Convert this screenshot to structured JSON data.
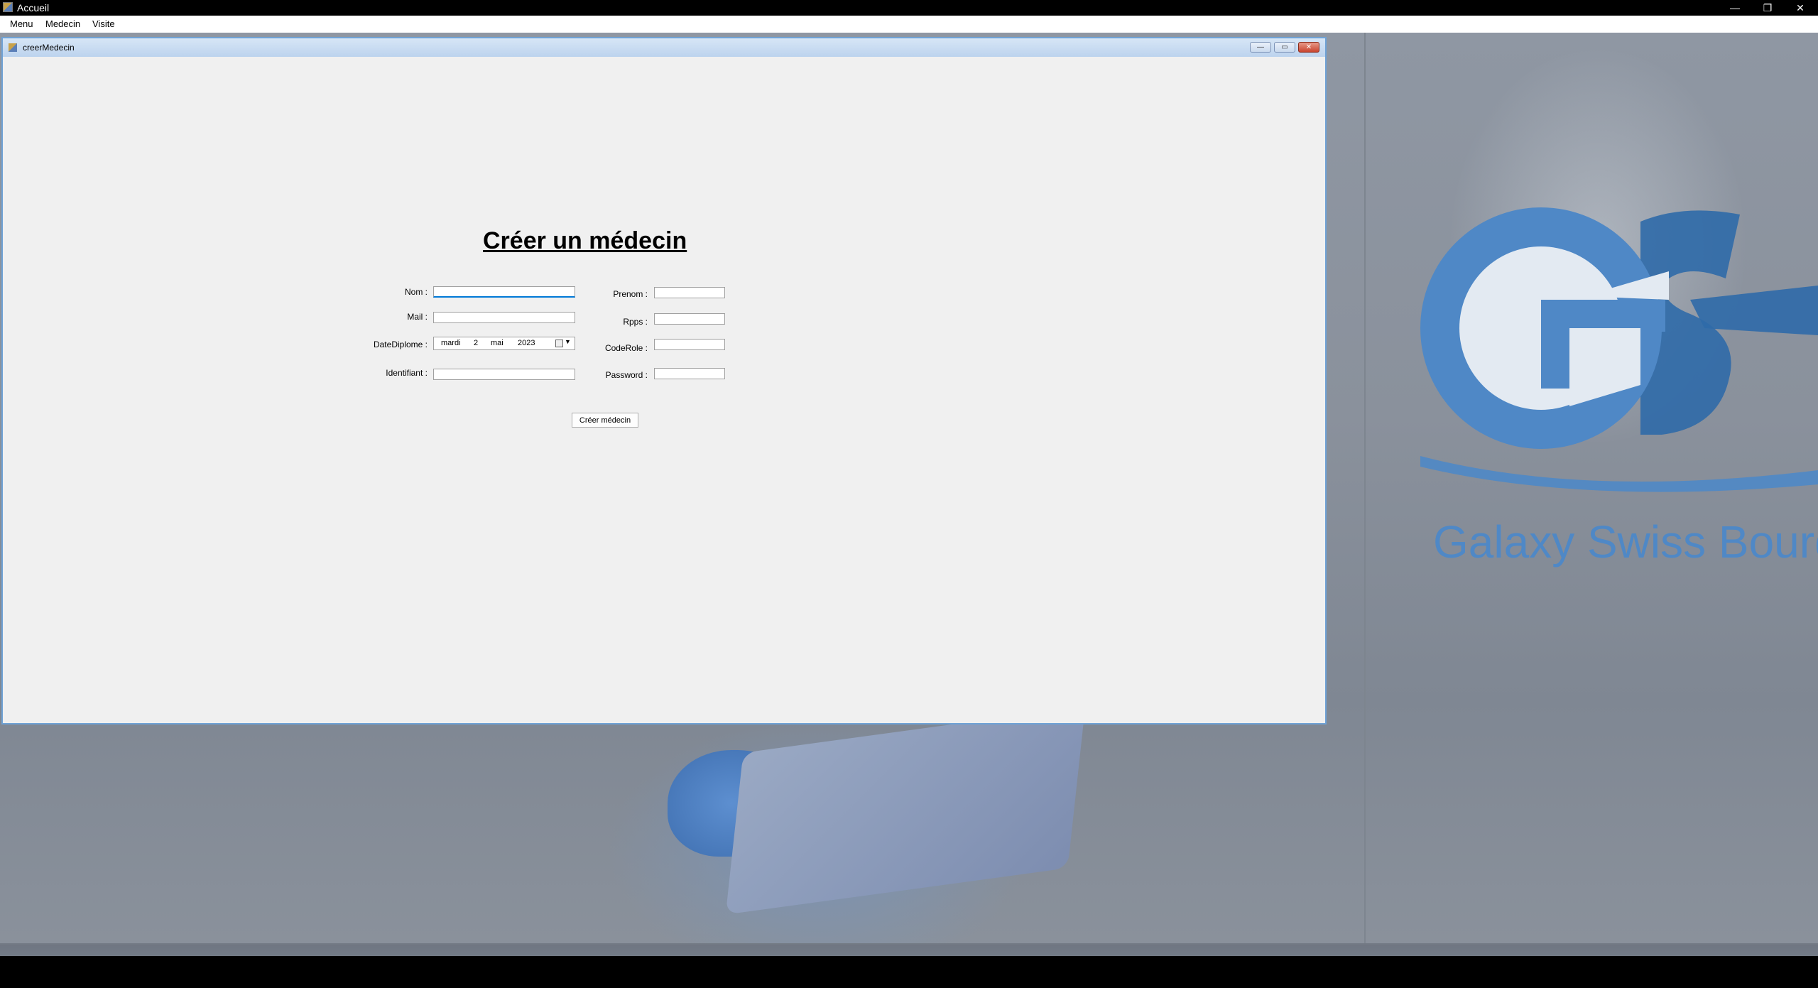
{
  "app": {
    "title": "Accueil",
    "controls": {
      "minimize": "—",
      "maximize": "❐",
      "close": "✕"
    }
  },
  "menu": {
    "items": [
      "Menu",
      "Medecin",
      "Visite"
    ]
  },
  "background": {
    "logo_text": "GSB",
    "tagline": "Galaxy Swiss Bourd",
    "logo_color": "#4f88c6"
  },
  "child_window": {
    "title": "creerMedecin",
    "controls": {
      "minimize": "—",
      "maximize": "▭",
      "close": "✕"
    }
  },
  "form": {
    "heading": "Créer un médecin",
    "labels": {
      "nom": "Nom :",
      "mail": "Mail :",
      "date_diplome": "DateDiplome :",
      "identifiant": "Identifiant :",
      "prenom": "Prenom :",
      "rpps": "Rpps :",
      "code_role": "CodeRole :",
      "password": "Password :"
    },
    "values": {
      "nom": "",
      "mail": "",
      "identifiant": "",
      "prenom": "",
      "rpps": "",
      "code_role": "",
      "password": ""
    },
    "date": {
      "day_name": "mardi",
      "day": "2",
      "month": "mai",
      "year": "2023"
    },
    "submit_label": "Créer médecin"
  }
}
